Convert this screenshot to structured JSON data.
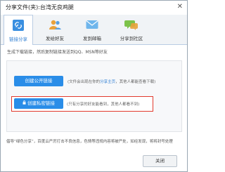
{
  "window": {
    "title": "分享文件(夹):台湾无良鸡腿",
    "close_glyph": "✕"
  },
  "tabs": [
    {
      "label": "链接分享",
      "icon": "link-icon",
      "active": true
    },
    {
      "label": "发给好友",
      "icon": "users-icon",
      "active": false
    },
    {
      "label": "发到邮箱",
      "icon": "mail-icon",
      "active": false
    },
    {
      "label": "分享到社区",
      "icon": "community-icon",
      "active": false
    }
  ],
  "intro": "生成下载链接，然后复制链接发送到QQ、MSN等好友",
  "public_link": {
    "button_label": "创建公开链接",
    "hint_before": "(文件会出现在你的",
    "hint_link": "分享主页",
    "hint_after": "，其他人都能查看下载)"
  },
  "private_link": {
    "button_label": "创建私密链接",
    "hint": "(只有分享的好友能看到，其他人都看不到)",
    "border_color": "#e23a2e"
  },
  "footer_notice": "倡导“绿色分享”，百度云严厉打击不良信息，色情等违规内容将被严处，如经发现，将将封号处理",
  "close_button": "关闭",
  "colors": {
    "accent": "#2a8de8",
    "highlight": "#e23a2e"
  }
}
